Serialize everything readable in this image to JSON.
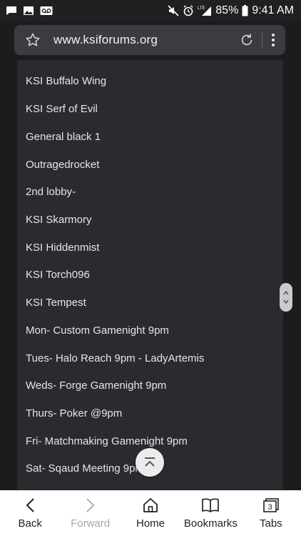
{
  "status_bar": {
    "battery": "85%",
    "time": "9:41 AM",
    "left_icons": [
      "chat-icon",
      "image-icon",
      "voicemail-icon"
    ],
    "right_icons": [
      "mute-icon",
      "alarm-icon",
      "lte-signal-icon",
      "battery-icon"
    ],
    "lte_label": "LTE"
  },
  "browser": {
    "url": "www.ksiforums.org"
  },
  "page": {
    "items": [
      "KSI Buffalo Wing",
      "KSI Serf of Evil",
      "General black 1",
      "Outragedrocket",
      "2nd lobby-",
      "KSI Skarmory",
      "KSI Hiddenmist",
      "KSI Torch096",
      "KSI Tempest",
      "Mon- Custom Gamenight 9pm",
      "Tues- Halo Reach 9pm - LadyArtemis",
      "Weds- Forge Gamenight 9pm",
      "Thurs- Poker @9pm",
      "Fri- Matchmaking Gamenight 9pm",
      "Sat- Sqaud Meeting 9pm"
    ]
  },
  "nav": {
    "back": "Back",
    "forward": "Forward",
    "home": "Home",
    "bookmarks": "Bookmarks",
    "tabs": "Tabs",
    "tab_count": "3"
  },
  "colors": {
    "page_background": "#2a2b2f",
    "url_bar": "#3b3c3f",
    "nav_bar": "#ffffff"
  }
}
